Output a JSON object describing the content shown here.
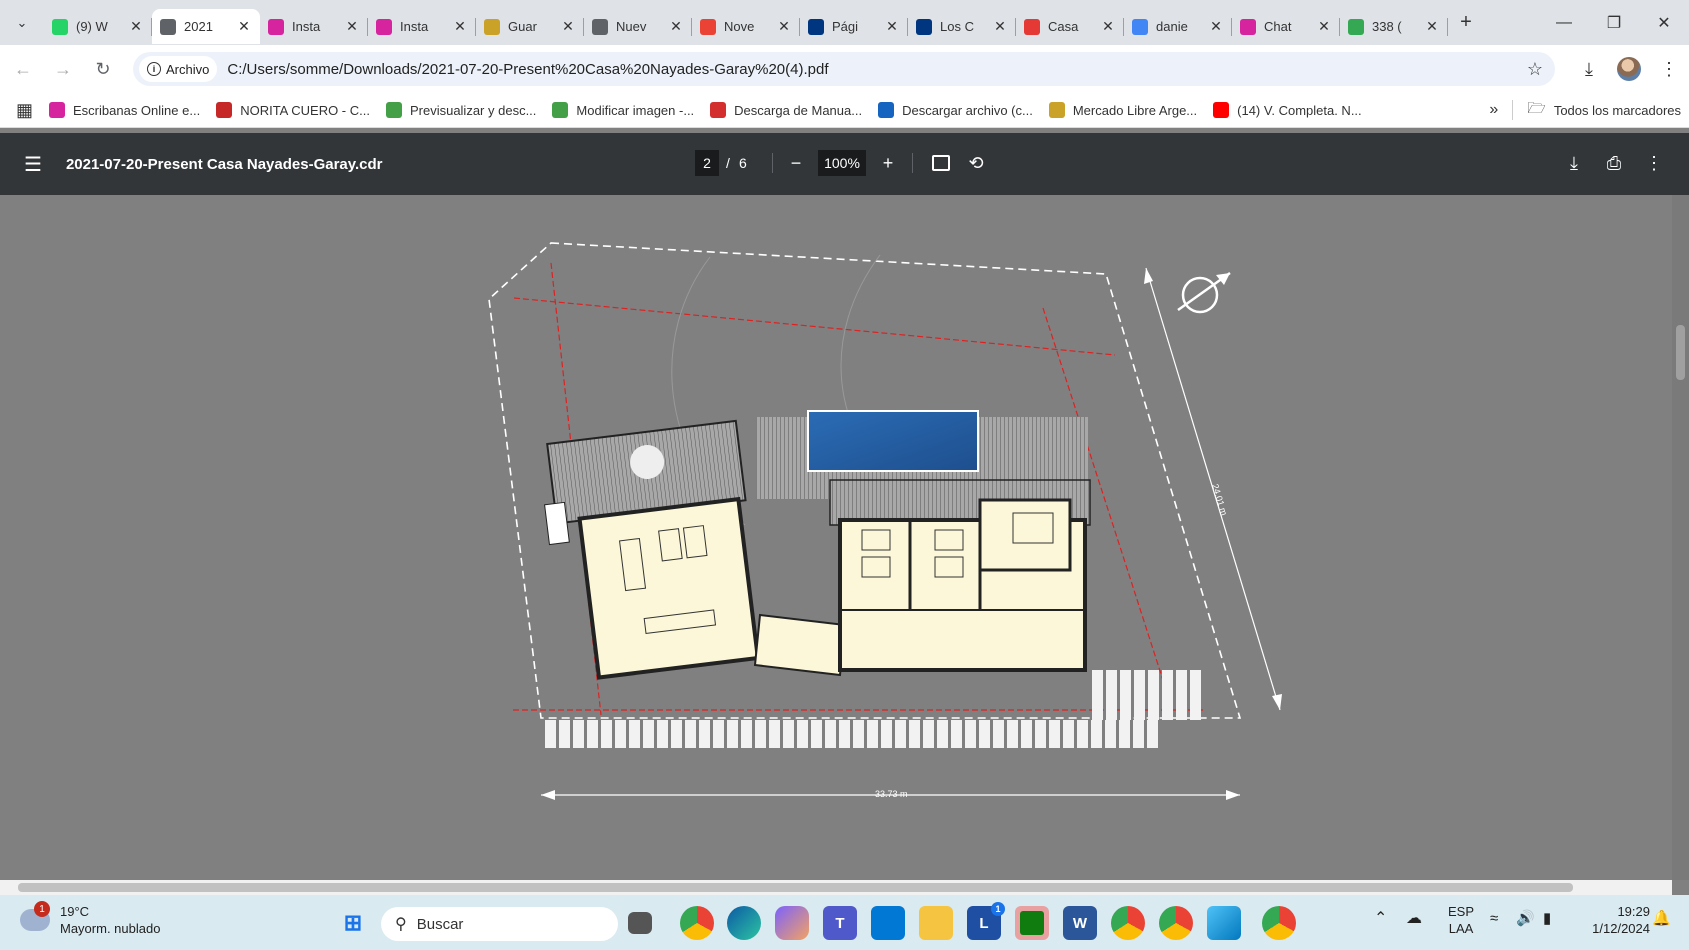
{
  "browser": {
    "tabs": [
      {
        "title": "(9) W",
        "icon": "whatsapp-icon",
        "color": "#25d366"
      },
      {
        "title": "2021",
        "icon": "globe-icon",
        "color": "#5f6368",
        "active": true
      },
      {
        "title": "Insta",
        "icon": "instagram-icon",
        "color": "#d6249f"
      },
      {
        "title": "Insta",
        "icon": "instagram-icon",
        "color": "#d6249f"
      },
      {
        "title": "Guar",
        "icon": "mercadolibre-icon",
        "color": "#c9a227"
      },
      {
        "title": "Nuev",
        "icon": "chrome-icon",
        "color": "#5f6368"
      },
      {
        "title": "Nove",
        "icon": "gmail-icon",
        "color": "#ea4335"
      },
      {
        "title": "Pági",
        "icon": "booking-icon",
        "color": "#003580"
      },
      {
        "title": "Los C",
        "icon": "booking-icon",
        "color": "#003580"
      },
      {
        "title": "Casa",
        "icon": "casa-icon",
        "color": "#e53935"
      },
      {
        "title": "danie",
        "icon": "google-icon",
        "color": "#4285f4"
      },
      {
        "title": "Chat",
        "icon": "instagram-icon",
        "color": "#d6249f"
      },
      {
        "title": "338 (",
        "icon": "maps-pin-icon",
        "color": "#34a853"
      }
    ],
    "security_chip": "Archivo",
    "url": "C:/Users/somme/Downloads/2021-07-20-Present%20Casa%20Nayades-Garay%20(4).pdf",
    "bookmarks": [
      {
        "label": "Escribanas Online e...",
        "icon": "instagram-icon",
        "color": "#d6249f"
      },
      {
        "label": "NORITA CUERO - C...",
        "icon": "b-icon",
        "color": "#c62828"
      },
      {
        "label": "Previsualizar y desc...",
        "icon": "rp-icon",
        "color": "#43a047"
      },
      {
        "label": "Modificar imagen -...",
        "icon": "rp-icon",
        "color": "#43a047"
      },
      {
        "label": "Descarga de Manua...",
        "icon": "psh-icon",
        "color": "#d32f2f"
      },
      {
        "label": "Descargar archivo (c...",
        "icon": "two-icon",
        "color": "#1565c0"
      },
      {
        "label": "Mercado Libre Arge...",
        "icon": "mercadolibre-icon",
        "color": "#c9a227"
      },
      {
        "label": "(14) V. Completa. N...",
        "icon": "youtube-icon",
        "color": "#ff0000"
      }
    ],
    "all_bookmarks": "Todos los marcadores"
  },
  "pdf": {
    "filename": "2021-07-20-Present Casa Nayades-Garay.cdr",
    "current_page": "2",
    "page_sep": "/",
    "total_pages": "6",
    "zoom": "100%"
  },
  "drawing": {
    "width_dimension": "33.73 m",
    "depth_dimension": "24.01 m"
  },
  "taskbar": {
    "weather_temp": "19°C",
    "weather_desc": "Mayorm. nublado",
    "weather_badge": "1",
    "search_placeholder": "Buscar",
    "lang_top": "ESP",
    "lang_bottom": "LAA",
    "time": "19:29",
    "date": "1/12/2024",
    "l_badge": "1"
  }
}
